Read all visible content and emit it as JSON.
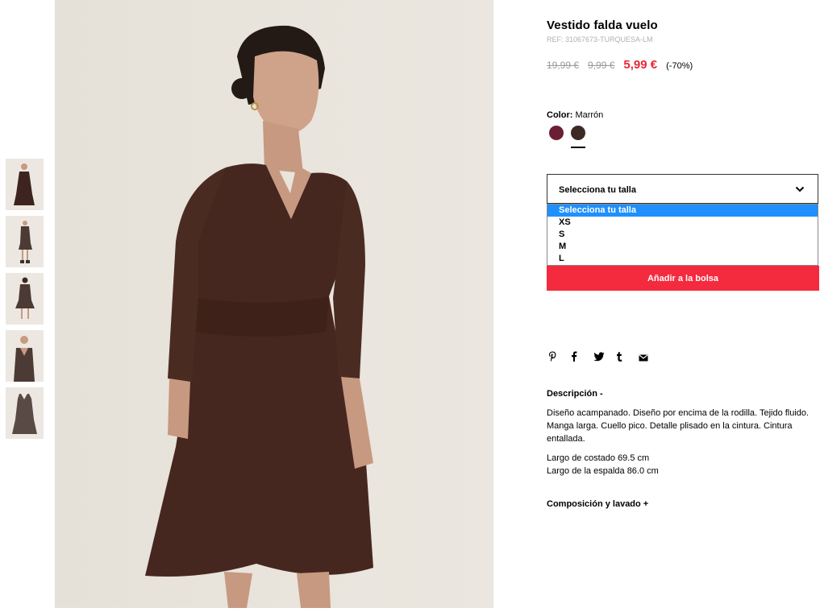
{
  "product": {
    "title": "Vestido falda vuelo",
    "ref": "REF: 31067673-TURQUESA-LM",
    "prices": {
      "original": "19,99 €",
      "previous": "9,99 €",
      "sale": "5,99 €",
      "discount": "(-70%)"
    },
    "color": {
      "label": "Color:",
      "value": "Marrón",
      "swatches": [
        "#6b1f35",
        "#3d2a24"
      ],
      "selected_index": 1
    }
  },
  "size_select": {
    "placeholder": "Selecciona tu talla",
    "options": [
      "Selecciona tu talla",
      "XS",
      "S",
      "M",
      "L"
    ],
    "highlighted_index": 0
  },
  "add_button": "Añadir a la bolsa",
  "social": [
    "pinterest-icon",
    "facebook-icon",
    "twitter-icon",
    "tumblr-icon",
    "email-icon"
  ],
  "description": {
    "heading": "Descripción -",
    "text": "Diseño acampanado. Diseño por encima de la rodilla. Tejido fluido. Manga larga. Cuello pico. Detalle plisado en la cintura. Cintura entallada.",
    "side_length": "Largo de costado 69.5 cm",
    "back_length": "Largo de la espalda 86.0 cm"
  },
  "composition": {
    "heading": "Composición y lavado +"
  },
  "colors": {
    "sale": "#e8273a",
    "button": "#f42a3e",
    "dress": "#4a2a22",
    "background": "#e9e5de"
  }
}
